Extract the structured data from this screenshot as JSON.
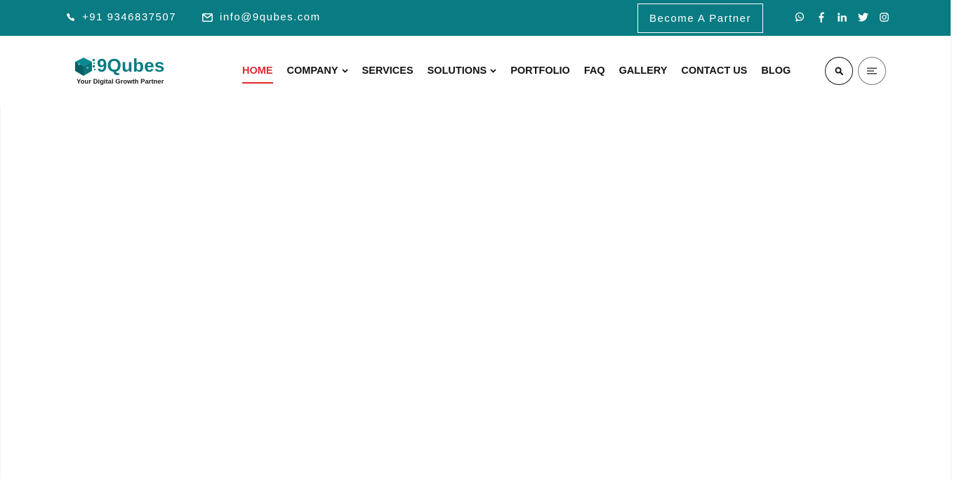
{
  "topbar": {
    "phone": "+91 9346837507",
    "email": "info@9qubes.com",
    "partner_label": "Become A Partner",
    "phone_icon": "phone-icon",
    "email_icon": "envelope-icon",
    "social_icons": [
      "whatsapp-icon",
      "facebook-icon",
      "linkedin-icon",
      "twitter-icon",
      "instagram-icon"
    ]
  },
  "logo": {
    "brand": "9Qubes",
    "tagline": "Your Digital Growth Partner"
  },
  "nav": {
    "items": [
      {
        "label": "HOME",
        "active": true
      },
      {
        "label": "COMPANY",
        "dropdown": true
      },
      {
        "label": "SERVICES"
      },
      {
        "label": "SOLUTIONS",
        "dropdown": true
      },
      {
        "label": "PORTFOLIO"
      },
      {
        "label": "FAQ"
      },
      {
        "label": "GALLERY"
      },
      {
        "label": "CONTACT US"
      },
      {
        "label": "BLOG"
      }
    ]
  },
  "colors": {
    "brand_teal": "#097b82",
    "active_red": "#e0282e",
    "text_dark": "#111111"
  }
}
